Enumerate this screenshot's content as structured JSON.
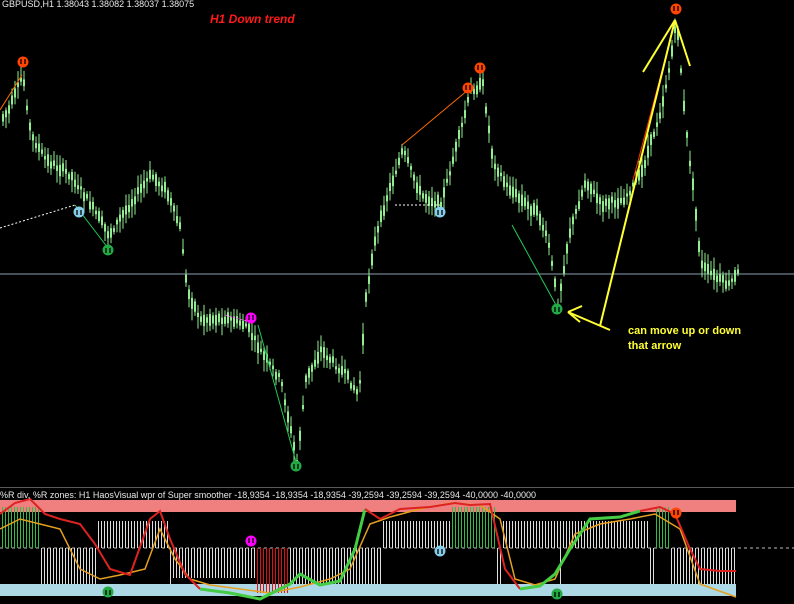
{
  "header": {
    "symbol_line": "GBPUSD,H1  1.38043 1.38082 1.38037 1.38075"
  },
  "annotations": {
    "trend_label": "H1 Down trend",
    "note_line1": "can move up or down",
    "note_line2": "that arrow"
  },
  "indicator": {
    "title": "%R div, %R zones: H1 HaosVisual wpr of Super smoother -18,9354 -18,9354 -18,9354 -39,2594 -39,2594 -39,2594 -40,0000 -40,0000"
  },
  "colors": {
    "background": "#000000",
    "candle": "#90ee90",
    "trend_label": "#ff1a1a",
    "note": "#ffff33",
    "up_arrow": "#ff4500",
    "down_arrow_green": "#22aa44",
    "down_arrow_blue": "#87ceeb",
    "magenta_arrow": "#ff00ff",
    "upper_zone": "#f08080",
    "lower_zone": "#add8e6"
  },
  "chart_data": {
    "type": "candlestick",
    "symbol": "GBPUSD",
    "timeframe": "H1",
    "ohlc": {
      "open": 1.38043,
      "high": 1.38082,
      "low": 1.38037,
      "close": 1.38075
    },
    "indicator_values": [
      -18.9354,
      -18.9354,
      -18.9354,
      -39.2594,
      -39.2594,
      -39.2594,
      -40.0,
      -40.0
    ],
    "grid": false
  }
}
